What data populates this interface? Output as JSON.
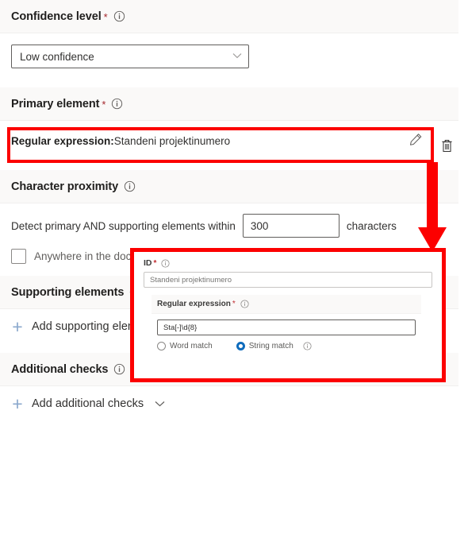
{
  "accent": {
    "annotation_red": "#fc0000",
    "required_star": "#a4262c",
    "radio_selected": "#0f6cbd",
    "plus_blue": "#8ba8cd"
  },
  "sections": {
    "confidence": {
      "title": "Confidence level",
      "required": "*",
      "info_icon": "info-icon",
      "dropdown": {
        "value": "Low confidence",
        "chevron_icon": "chevron-down-icon"
      }
    },
    "primary_element": {
      "title": "Primary element",
      "required": "*",
      "info_icon": "info-icon",
      "row": {
        "label": "Regular expression:",
        "value": "Standeni projektinumero",
        "edit_icon": "pencil-icon",
        "delete_icon": "trash-icon"
      }
    },
    "character_proximity": {
      "title": "Character proximity",
      "info_icon": "info-icon",
      "detect_prefix": "Detect primary AND supporting elements within",
      "detect_value": "300",
      "detect_suffix": "characters",
      "anywhere_checkbox_label": "Anywhere in the document",
      "checkbox_icon": "checkbox-unchecked-icon"
    },
    "supporting_elements": {
      "title": "Supporting elements",
      "info_icon": "info-icon",
      "add_label": "Add supporting element",
      "plus_icon": "plus-icon"
    },
    "additional_checks": {
      "title": "Additional checks",
      "info_icon": "info-icon",
      "add_label": "Add additional checks",
      "plus_icon": "plus-icon",
      "chevron_icon": "chevron-down-icon"
    }
  },
  "overlay_panel": {
    "id_field": {
      "label": "ID",
      "required": "*",
      "info_icon": "info-icon",
      "value": "Standeni projektinumero"
    },
    "regex_section": {
      "title": "Regular expression",
      "required": "*",
      "info_icon": "info-icon",
      "value": "Sta[-]\\d{8}",
      "options": [
        {
          "label": "Word match",
          "selected": false
        },
        {
          "label": "String match",
          "selected": true
        }
      ],
      "options_info_icon": "info-icon"
    }
  },
  "annotations": {
    "highlight_box": "red-highlight-box",
    "arrow": "red-down-arrow"
  }
}
